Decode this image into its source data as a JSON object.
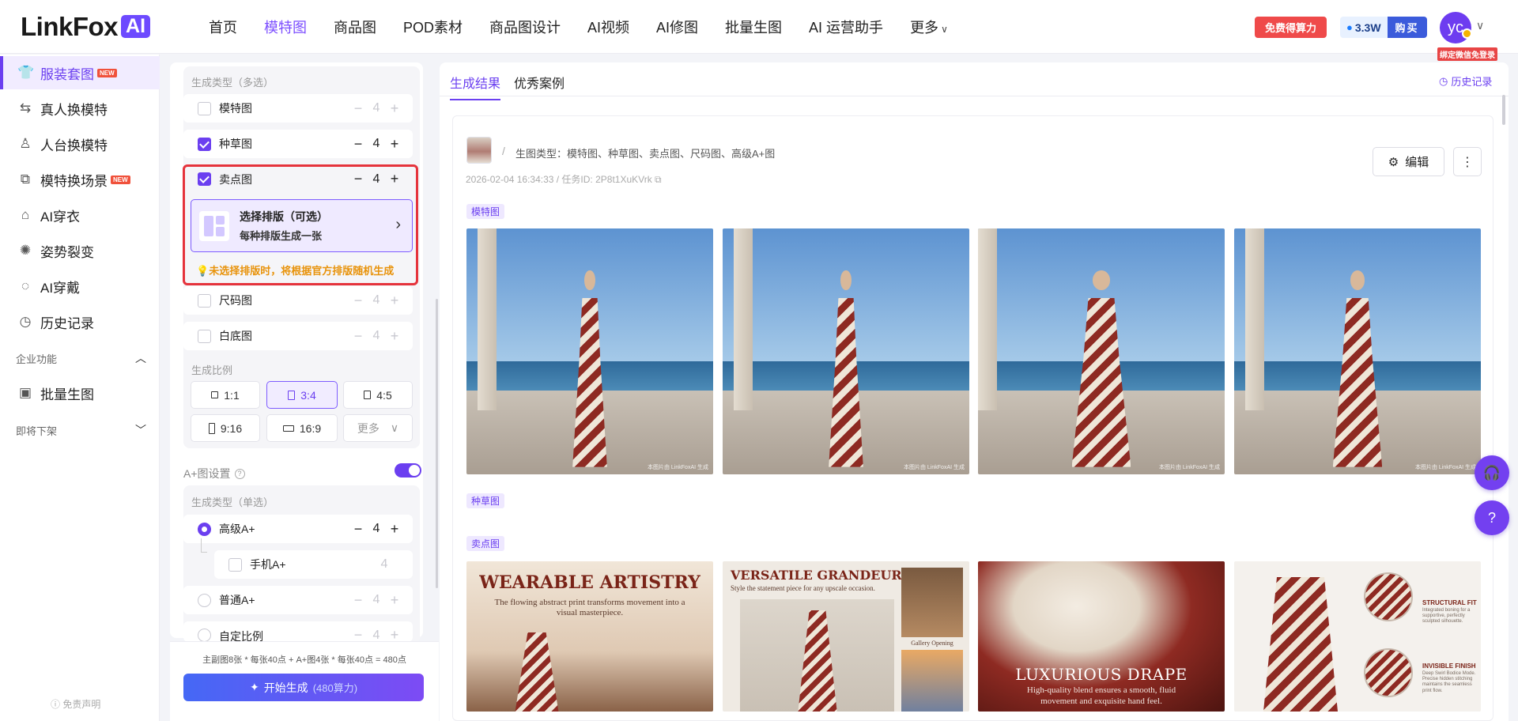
{
  "brand": {
    "name": "LinkFox",
    "suffix": "AI"
  },
  "nav": {
    "items": [
      "首页",
      "模特图",
      "商品图",
      "POD素材",
      "商品图设计",
      "AI视频",
      "AI修图",
      "批量生图",
      "AI 运营助手"
    ],
    "active": "模特图",
    "more": "更多"
  },
  "header": {
    "free_btn": "免费得算力",
    "points": "3.3W",
    "buy": "购买",
    "avatar": "yc",
    "bind_tip": "绑定微信免登录"
  },
  "sidebar": {
    "items": [
      {
        "label": "服装套图",
        "icon": "tshirt-icon",
        "badge": "NEW",
        "active": true
      },
      {
        "label": "真人换模特",
        "icon": "swap-person-icon"
      },
      {
        "label": "人台换模特",
        "icon": "mannequin-icon"
      },
      {
        "label": "模特换场景",
        "icon": "scene-swap-icon",
        "badge": "NEW"
      },
      {
        "label": "AI穿衣",
        "icon": "hanger-icon"
      },
      {
        "label": "姿势裂变",
        "icon": "pose-icon"
      },
      {
        "label": "AI穿戴",
        "icon": "accessory-icon"
      },
      {
        "label": "历史记录",
        "icon": "clock-icon"
      }
    ],
    "group_enterprise": "企业功能",
    "enterprise_items": [
      {
        "label": "批量生图",
        "icon": "image-icon"
      }
    ],
    "group_soon": "即将下架",
    "disclaimer": "免责声明"
  },
  "settings": {
    "types_title": "生成类型（多选）",
    "types": [
      {
        "label": "模特图",
        "checked": false,
        "count": "4"
      },
      {
        "label": "种草图",
        "checked": true,
        "count": "4"
      },
      {
        "label": "卖点图",
        "checked": true,
        "count": "4"
      },
      {
        "label": "尺码图",
        "checked": false,
        "count": "4"
      },
      {
        "label": "白底图",
        "checked": false,
        "count": "4"
      }
    ],
    "layout_title": "选择排版（可选）",
    "layout_sub": "每种排版生成一张",
    "layout_tip": "未选择排版时，将根据官方排版随机生成",
    "ratio_title": "生成比例",
    "ratios": [
      "1:1",
      "3:4",
      "4:5",
      "9:16",
      "16:9"
    ],
    "ratio_active": "3:4",
    "ratio_more": "更多",
    "aplus_label": "A+图设置",
    "aplus_enabled": true,
    "aplus_title": "生成类型（单选）",
    "aplus_types": [
      {
        "label": "高级A+",
        "selected": true,
        "count": "4"
      },
      {
        "label": "手机A+",
        "count": "4"
      },
      {
        "label": "普通A+",
        "selected": false,
        "count": "4"
      },
      {
        "label": "自定比例",
        "selected": false,
        "count": "4"
      }
    ],
    "formula": "主副图8张 * 每张40点 + A+图4张 * 每张40点 = 480点",
    "generate": "开始生成",
    "generate_cost": "(480算力)"
  },
  "results": {
    "tabs": [
      "生成结果",
      "优秀案例"
    ],
    "active_tab": "生成结果",
    "history": "历史记录",
    "task_types": "生图类型：模特图、种草图、卖点图、尺码图、高级A+图",
    "task_meta": "2026-02-04 16:34:33 / 任务ID: 2P8t1XuKVrk",
    "edit": "编辑",
    "sections": [
      "模特图",
      "种草图",
      "卖点图"
    ],
    "watermark": "本图片由 LinkFoxAI 生成",
    "selling": [
      {
        "headline": "WEARABLE ARTISTRY",
        "sub": "The flowing abstract print transforms movement into a visual masterpiece."
      },
      {
        "headline": "VERSATILE GRANDEUR",
        "sub": "Style the statement piece for any upscale occasion.",
        "caption": "Gallery Opening"
      },
      {
        "headline": "LUXURIOUS DRAPE",
        "sub": "High-quality blend ensures a smooth, fluid movement and exquisite hand feel."
      },
      {
        "label1": "STRUCTURAL FIT",
        "desc1": "Integrated boning for a supportive, perfectly sculpted silhouette.",
        "label2": "INVISIBLE FINISH",
        "desc2": "Deep Swirl Bodice Mode. Precise hidden stitching maintains the seamless print flow."
      }
    ]
  }
}
